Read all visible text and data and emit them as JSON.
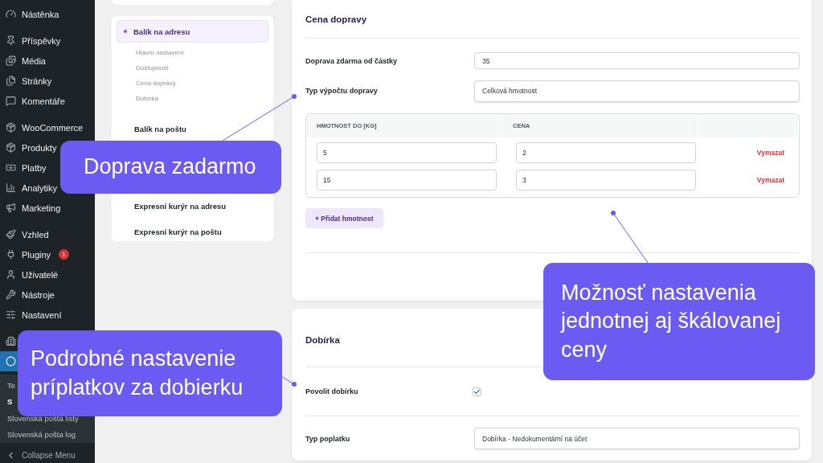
{
  "sidebar": {
    "groups": [
      [
        {
          "label": "Nástěnka",
          "selected": false
        }
      ],
      [
        {
          "label": "Příspěvky",
          "selected": false
        },
        {
          "label": "Média",
          "selected": false
        },
        {
          "label": "Stránky",
          "selected": false
        },
        {
          "label": "Komentáře",
          "selected": false
        }
      ],
      [
        {
          "label": "WooCommerce",
          "selected": false
        },
        {
          "label": "Produkty",
          "selected": false
        },
        {
          "label": "Platby",
          "selected": false
        },
        {
          "label": "Analytiky",
          "selected": false
        },
        {
          "label": "Marketing",
          "selected": false
        }
      ],
      [
        {
          "label": "Vzhled",
          "selected": false
        },
        {
          "label": "Pluginy",
          "selected": false,
          "badge": "1"
        },
        {
          "label": "Uživatelé",
          "selected": false
        },
        {
          "label": "Nástroje",
          "selected": false
        },
        {
          "label": "Nastavení",
          "selected": false
        }
      ],
      [
        {
          "selected": false
        },
        {
          "selected": true
        }
      ]
    ],
    "submenu": [
      {
        "label": "Te",
        "selected": false
      },
      {
        "label": "S",
        "selected": true
      },
      {
        "label": "Slovenská pošta listy",
        "selected": false
      },
      {
        "label": "Slovenská pošta log",
        "selected": false
      }
    ],
    "collapse": "Collapse Menu"
  },
  "nav": {
    "items": [
      {
        "label": "Balík na adresu",
        "selected": true,
        "children": [
          {
            "label": "Hlavní nastavení"
          },
          {
            "label": "Dostupnost"
          },
          {
            "label": "Cena dopravy"
          },
          {
            "label": "Dobírka"
          }
        ]
      },
      {
        "label": "Balík na poštu",
        "selected": false
      },
      {
        "label": "Expresní kurýr na adresu",
        "selected": false
      },
      {
        "label": "Expresní kurýr na poštu",
        "selected": false
      }
    ]
  },
  "shipping_price": {
    "title": "Cena dopravy",
    "fields": [
      {
        "label": "Doprava zdarma od částky",
        "kind": "input",
        "value": "35"
      },
      {
        "label": "Typ výpočtu dopravy",
        "kind": "select",
        "value": "Celková hmotnost"
      }
    ],
    "table": {
      "columns": [
        "HMOTNOST DO [KG]",
        "CENA"
      ],
      "rows": [
        {
          "weight": "5",
          "price": "2",
          "action": "Vymazat"
        },
        {
          "weight": "15",
          "price": "3",
          "action": "Vymazat"
        }
      ]
    },
    "add_button": "+ Přidat hmotnost"
  },
  "cod": {
    "title": "Dobírka",
    "fields": [
      {
        "label": "Povolit dobírku",
        "kind": "checkbox",
        "checked": true
      },
      {
        "label": "Typ poplatku",
        "kind": "select",
        "value": "Dobírka - Nedokumentární na účet"
      }
    ]
  },
  "callouts": [
    {
      "text": "Doprava zadarmo"
    },
    {
      "text": "Možnosť nastavenia jednotnej aj škálovanej ceny"
    },
    {
      "text": "Podrobné nastavenie príplatkov za dobierku"
    }
  ]
}
